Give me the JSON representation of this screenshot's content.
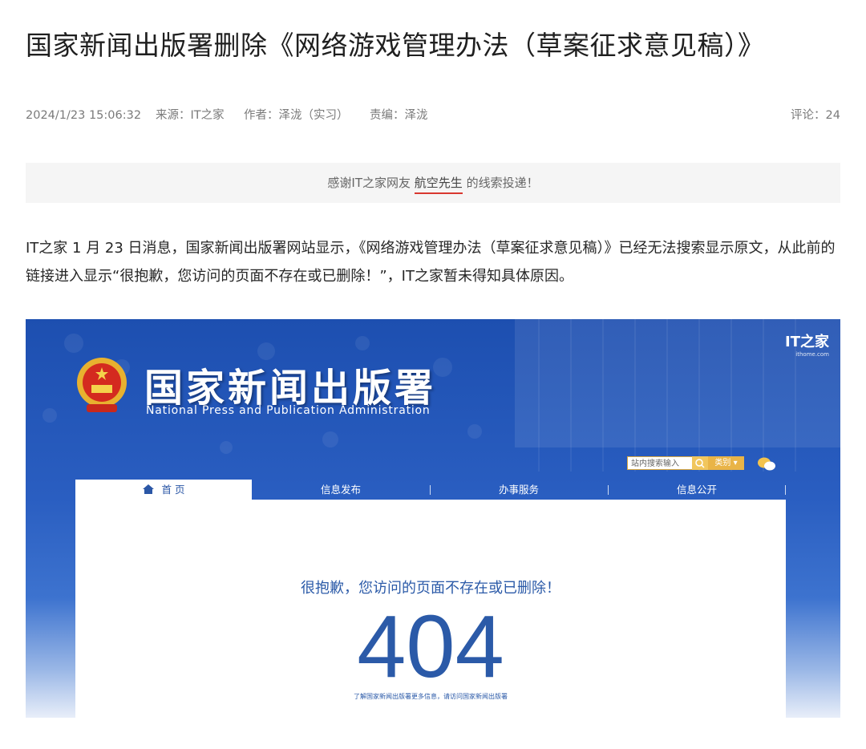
{
  "article": {
    "title": "国家新闻出版署删除《网络游戏管理办法（草案征求意见稿）》",
    "date": "2024/1/23 15:06:32",
    "source": "来源：IT之家",
    "author": "作者：泽泷（实习）",
    "editor": "责编：泽泷",
    "comments": "评论：24",
    "thanks_prefix": "感谢IT之家网友 ",
    "thanks_user": "航空先生",
    "thanks_suffix": " 的线索投递！",
    "body": "IT之家 1 月 23 日消息，国家新闻出版署网站显示，《网络游戏管理办法（草案征求意见稿）》已经无法搜索显示原文，从此前的链接进入显示“很抱歉，您访问的页面不存在或已删除！”，IT之家暂未得知具体原因。"
  },
  "screenshot": {
    "watermark": "IT之家",
    "watermark_url": "ithome.com",
    "site_name": "国家新闻出版署",
    "site_name_en": "National  Press and Publication Administration",
    "search_placeholder": "站内搜索输入",
    "category_label": "类别",
    "nav": [
      "首 页",
      "信息发布",
      "办事服务",
      "信息公开"
    ],
    "error_message": "很抱歉，您访问的页面不存在或已删除！",
    "error_code": "404",
    "error_tip": "了解国家新闻出版署更多信息，请访问国家新闻出版署"
  },
  "colors": {
    "accent_underline": "#d9382f",
    "site_blue": "#2b5aa8",
    "nav_bar": "#2654b0"
  }
}
